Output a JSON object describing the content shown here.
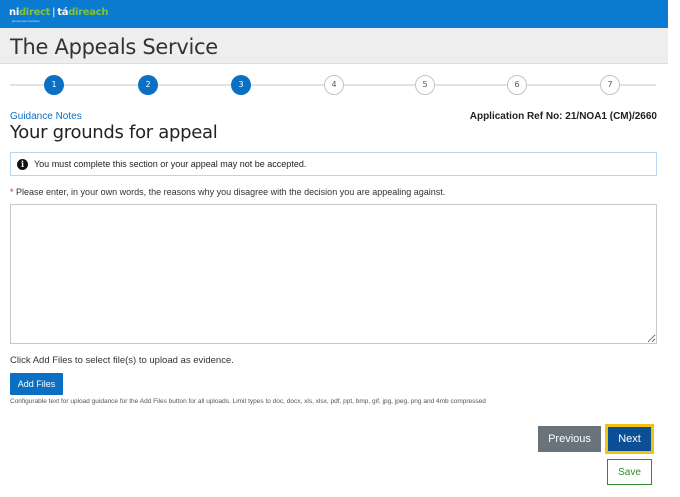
{
  "header": {
    "logo": {
      "part1": "ni",
      "part2": "direct",
      "separator": "|",
      "part3": "tá",
      "part4": "direach",
      "subtitle": "government services"
    },
    "service_title": "The Appeals Service"
  },
  "stepper": {
    "steps": [
      {
        "label": "1",
        "state": "completed"
      },
      {
        "label": "2",
        "state": "completed"
      },
      {
        "label": "3",
        "state": "current"
      },
      {
        "label": "4",
        "state": "upcoming"
      },
      {
        "label": "5",
        "state": "upcoming"
      },
      {
        "label": "6",
        "state": "upcoming"
      },
      {
        "label": "7",
        "state": "upcoming"
      }
    ]
  },
  "page": {
    "guidance_link": "Guidance Notes",
    "application_ref": "Application Ref No: 21/NOA1 (CM)/2660",
    "title": "Your grounds for appeal"
  },
  "alert": {
    "icon": "info-icon",
    "text": "You must complete this section or your appeal may not be accepted."
  },
  "form": {
    "required_marker": "*",
    "grounds_label": " Please enter, in your own words, the reasons why you disagree with the decision you are appealing against.",
    "grounds_value": ""
  },
  "upload": {
    "hint": "Click Add Files to select file(s) to upload as evidence.",
    "add_files_label": "Add Files",
    "guidance_text": "Configurable text for upload guidance for the Add Files button for all uploads. Limit types to doc, docx, xls, xlsx, pdf, ppt, bmp, gif, jpg, jpeg, png and 4mb compressed"
  },
  "actions": {
    "previous_label": "Previous",
    "next_label": "Next",
    "save_label": "Save"
  },
  "colors": {
    "brand_blue": "#0b7ad1",
    "step_active": "#0b6fc4",
    "next_button": "#0b4f97",
    "focus_ring": "#f3c014",
    "save_green": "#2f8c2f"
  }
}
